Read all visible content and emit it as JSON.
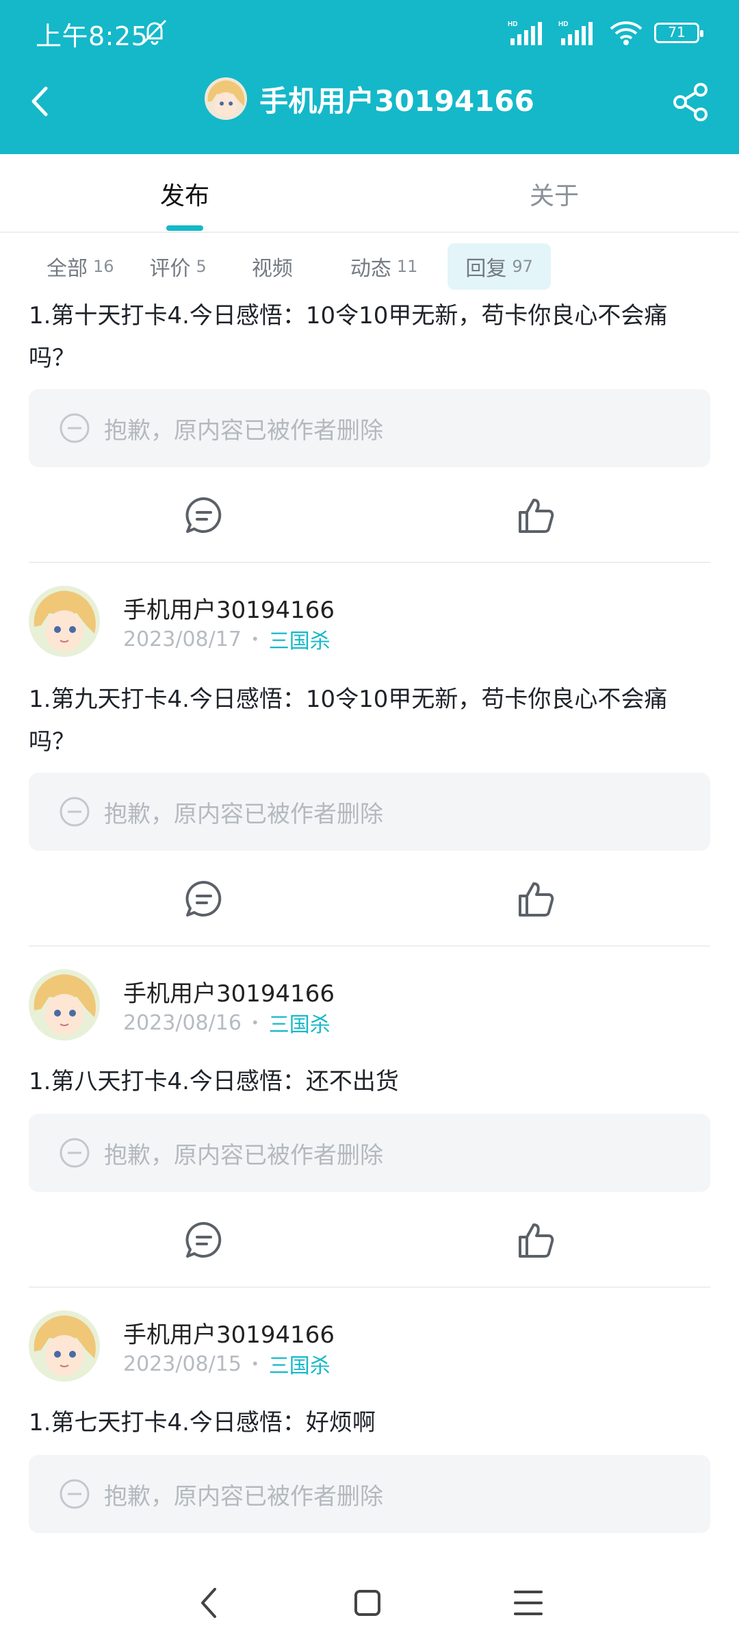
{
  "status_bar": {
    "time": "上午8:25",
    "battery": "71"
  },
  "header": {
    "title": "手机用户30194166"
  },
  "tabs": [
    {
      "label": "发布"
    },
    {
      "label": "关于"
    }
  ],
  "filters": [
    {
      "label": "全部",
      "count": "16"
    },
    {
      "label": "评价",
      "count": "5"
    },
    {
      "label": "视频",
      "count": ""
    },
    {
      "label": "动态",
      "count": "11"
    },
    {
      "label": "回复",
      "count": "97"
    }
  ],
  "deleted_text": "抱歉，原内容已被作者删除",
  "posts": [
    {
      "user": "",
      "date": "",
      "tag": "",
      "text": "1.第十天打卡4.今日感悟：10令10甲无新，苟卡你良心不会痛吗？"
    },
    {
      "user": "手机用户30194166",
      "date": "2023/08/17",
      "tag": "三国杀",
      "text": "1.第九天打卡4.今日感悟：10令10甲无新，苟卡你良心不会痛吗？"
    },
    {
      "user": "手机用户30194166",
      "date": "2023/08/16",
      "tag": "三国杀",
      "text": "1.第八天打卡4.今日感悟：还不出货"
    },
    {
      "user": "手机用户30194166",
      "date": "2023/08/15",
      "tag": "三国杀",
      "text": "1.第七天打卡4.今日感悟：好烦啊"
    }
  ],
  "colors": {
    "accent": "#14b8c9",
    "chip_active_bg": "#e3f5f8",
    "deleted_bg": "#f3f5f7"
  },
  "icons": [
    "back-icon",
    "share-icon",
    "comment-icon",
    "like-icon",
    "minus-circle-icon",
    "mute-icon",
    "wifi-icon",
    "battery-icon"
  ]
}
